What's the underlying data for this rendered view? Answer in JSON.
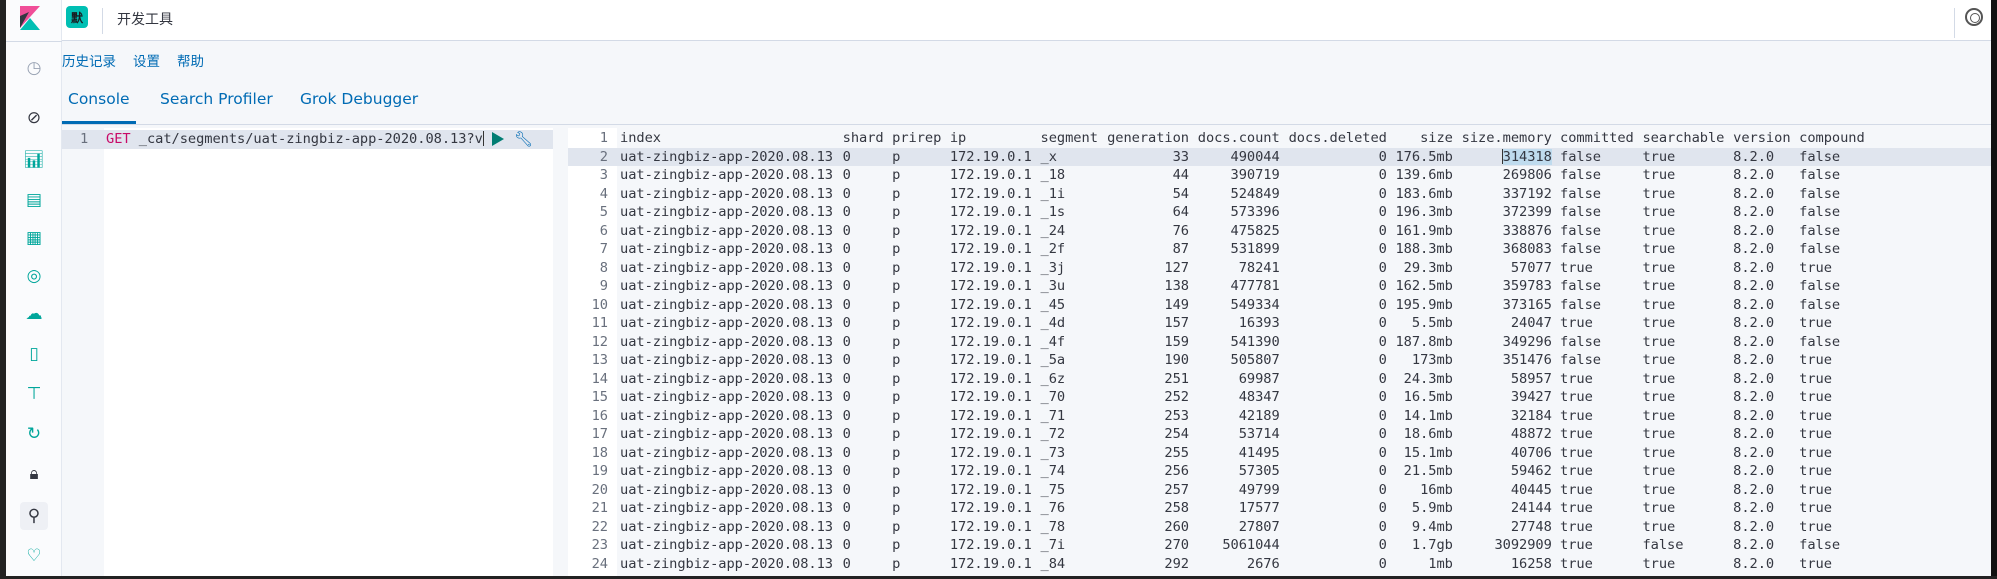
{
  "header": {
    "space_badge": "默",
    "title": "开发工具"
  },
  "topnav": [
    "历史记录",
    "设置",
    "帮助"
  ],
  "tabs": [
    {
      "label": "Console",
      "active": true
    },
    {
      "label": "Search Profiler"
    },
    {
      "label": "Grok Debugger"
    }
  ],
  "editor": {
    "line_number": "1",
    "method": "GET",
    "path": " _cat/segments/uat-zingbiz-app-2020.08.13?v"
  },
  "colors": {
    "accent": "#006bb4",
    "badge": "#00bfb3",
    "method": "#c80a68",
    "run": "#017d73"
  },
  "output": {
    "columns": [
      "index",
      "shard",
      "prirep",
      "ip",
      "segment",
      "generation",
      "docs.count",
      "docs.deleted",
      "size",
      "size.memory",
      "committed",
      "searchable",
      "version",
      "compound"
    ],
    "rows": [
      [
        "uat-zingbiz-app-2020.08.13",
        "0",
        "p",
        "172.19.0.1",
        "_x",
        "33",
        "490044",
        "0",
        "176.5mb",
        "314318",
        "false",
        "true",
        "8.2.0",
        "false"
      ],
      [
        "uat-zingbiz-app-2020.08.13",
        "0",
        "p",
        "172.19.0.1",
        "_18",
        "44",
        "390719",
        "0",
        "139.6mb",
        "269806",
        "false",
        "true",
        "8.2.0",
        "false"
      ],
      [
        "uat-zingbiz-app-2020.08.13",
        "0",
        "p",
        "172.19.0.1",
        "_1i",
        "54",
        "524849",
        "0",
        "183.6mb",
        "337192",
        "false",
        "true",
        "8.2.0",
        "false"
      ],
      [
        "uat-zingbiz-app-2020.08.13",
        "0",
        "p",
        "172.19.0.1",
        "_1s",
        "64",
        "573396",
        "0",
        "196.3mb",
        "372399",
        "false",
        "true",
        "8.2.0",
        "false"
      ],
      [
        "uat-zingbiz-app-2020.08.13",
        "0",
        "p",
        "172.19.0.1",
        "_24",
        "76",
        "475825",
        "0",
        "161.9mb",
        "338876",
        "false",
        "true",
        "8.2.0",
        "false"
      ],
      [
        "uat-zingbiz-app-2020.08.13",
        "0",
        "p",
        "172.19.0.1",
        "_2f",
        "87",
        "531899",
        "0",
        "188.3mb",
        "368083",
        "false",
        "true",
        "8.2.0",
        "false"
      ],
      [
        "uat-zingbiz-app-2020.08.13",
        "0",
        "p",
        "172.19.0.1",
        "_3j",
        "127",
        "78241",
        "0",
        "29.3mb",
        "57077",
        "true",
        "true",
        "8.2.0",
        "true"
      ],
      [
        "uat-zingbiz-app-2020.08.13",
        "0",
        "p",
        "172.19.0.1",
        "_3u",
        "138",
        "477781",
        "0",
        "162.5mb",
        "359783",
        "false",
        "true",
        "8.2.0",
        "false"
      ],
      [
        "uat-zingbiz-app-2020.08.13",
        "0",
        "p",
        "172.19.0.1",
        "_45",
        "149",
        "549334",
        "0",
        "195.9mb",
        "373165",
        "false",
        "true",
        "8.2.0",
        "false"
      ],
      [
        "uat-zingbiz-app-2020.08.13",
        "0",
        "p",
        "172.19.0.1",
        "_4d",
        "157",
        "16393",
        "0",
        "5.5mb",
        "24047",
        "true",
        "true",
        "8.2.0",
        "true"
      ],
      [
        "uat-zingbiz-app-2020.08.13",
        "0",
        "p",
        "172.19.0.1",
        "_4f",
        "159",
        "541390",
        "0",
        "187.8mb",
        "349296",
        "false",
        "true",
        "8.2.0",
        "false"
      ],
      [
        "uat-zingbiz-app-2020.08.13",
        "0",
        "p",
        "172.19.0.1",
        "_5a",
        "190",
        "505807",
        "0",
        "173mb",
        "351476",
        "false",
        "true",
        "8.2.0",
        "true"
      ],
      [
        "uat-zingbiz-app-2020.08.13",
        "0",
        "p",
        "172.19.0.1",
        "_6z",
        "251",
        "69987",
        "0",
        "24.3mb",
        "58957",
        "true",
        "true",
        "8.2.0",
        "true"
      ],
      [
        "uat-zingbiz-app-2020.08.13",
        "0",
        "p",
        "172.19.0.1",
        "_70",
        "252",
        "48347",
        "0",
        "16.5mb",
        "39427",
        "true",
        "true",
        "8.2.0",
        "true"
      ],
      [
        "uat-zingbiz-app-2020.08.13",
        "0",
        "p",
        "172.19.0.1",
        "_71",
        "253",
        "42189",
        "0",
        "14.1mb",
        "32184",
        "true",
        "true",
        "8.2.0",
        "true"
      ],
      [
        "uat-zingbiz-app-2020.08.13",
        "0",
        "p",
        "172.19.0.1",
        "_72",
        "254",
        "53714",
        "0",
        "18.6mb",
        "48872",
        "true",
        "true",
        "8.2.0",
        "true"
      ],
      [
        "uat-zingbiz-app-2020.08.13",
        "0",
        "p",
        "172.19.0.1",
        "_73",
        "255",
        "41495",
        "0",
        "15.1mb",
        "40706",
        "true",
        "true",
        "8.2.0",
        "true"
      ],
      [
        "uat-zingbiz-app-2020.08.13",
        "0",
        "p",
        "172.19.0.1",
        "_74",
        "256",
        "57305",
        "0",
        "21.5mb",
        "59462",
        "true",
        "true",
        "8.2.0",
        "true"
      ],
      [
        "uat-zingbiz-app-2020.08.13",
        "0",
        "p",
        "172.19.0.1",
        "_75",
        "257",
        "49799",
        "0",
        "16mb",
        "40445",
        "true",
        "true",
        "8.2.0",
        "true"
      ],
      [
        "uat-zingbiz-app-2020.08.13",
        "0",
        "p",
        "172.19.0.1",
        "_76",
        "258",
        "17577",
        "0",
        "5.9mb",
        "24144",
        "true",
        "true",
        "8.2.0",
        "true"
      ],
      [
        "uat-zingbiz-app-2020.08.13",
        "0",
        "p",
        "172.19.0.1",
        "_78",
        "260",
        "27807",
        "0",
        "9.4mb",
        "27748",
        "true",
        "true",
        "8.2.0",
        "true"
      ],
      [
        "uat-zingbiz-app-2020.08.13",
        "0",
        "p",
        "172.19.0.1",
        "_7i",
        "270",
        "5061044",
        "0",
        "1.7gb",
        "3092909",
        "true",
        "false",
        "8.2.0",
        "false"
      ],
      [
        "uat-zingbiz-app-2020.08.13",
        "0",
        "p",
        "172.19.0.1",
        "_84",
        "292",
        "2676",
        "0",
        "1mb",
        "16258",
        "true",
        "true",
        "8.2.0",
        "true"
      ]
    ]
  }
}
